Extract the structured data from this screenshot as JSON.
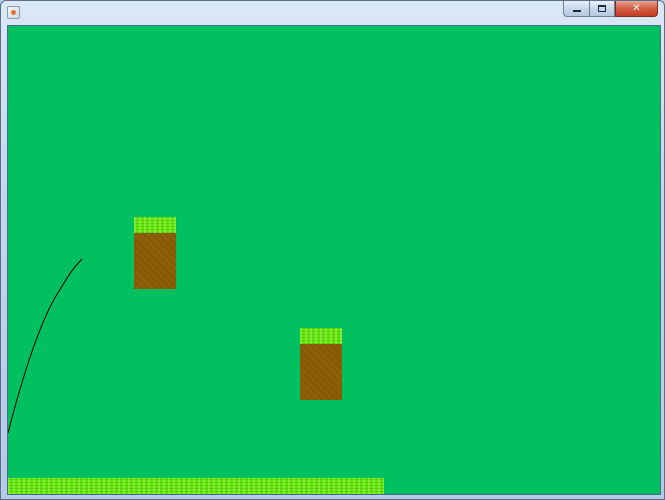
{
  "window": {
    "title": "",
    "icon": "java-coffee-cup-icon",
    "buttons": {
      "minimize_icon": "minimize-icon",
      "maximize_icon": "maximize-icon",
      "close_label": "✕"
    }
  },
  "game": {
    "background_color": "#00c060",
    "grass_color": "#5fe80a",
    "dirt_color": "#8c5f08",
    "trajectory_color": "#000000"
  }
}
